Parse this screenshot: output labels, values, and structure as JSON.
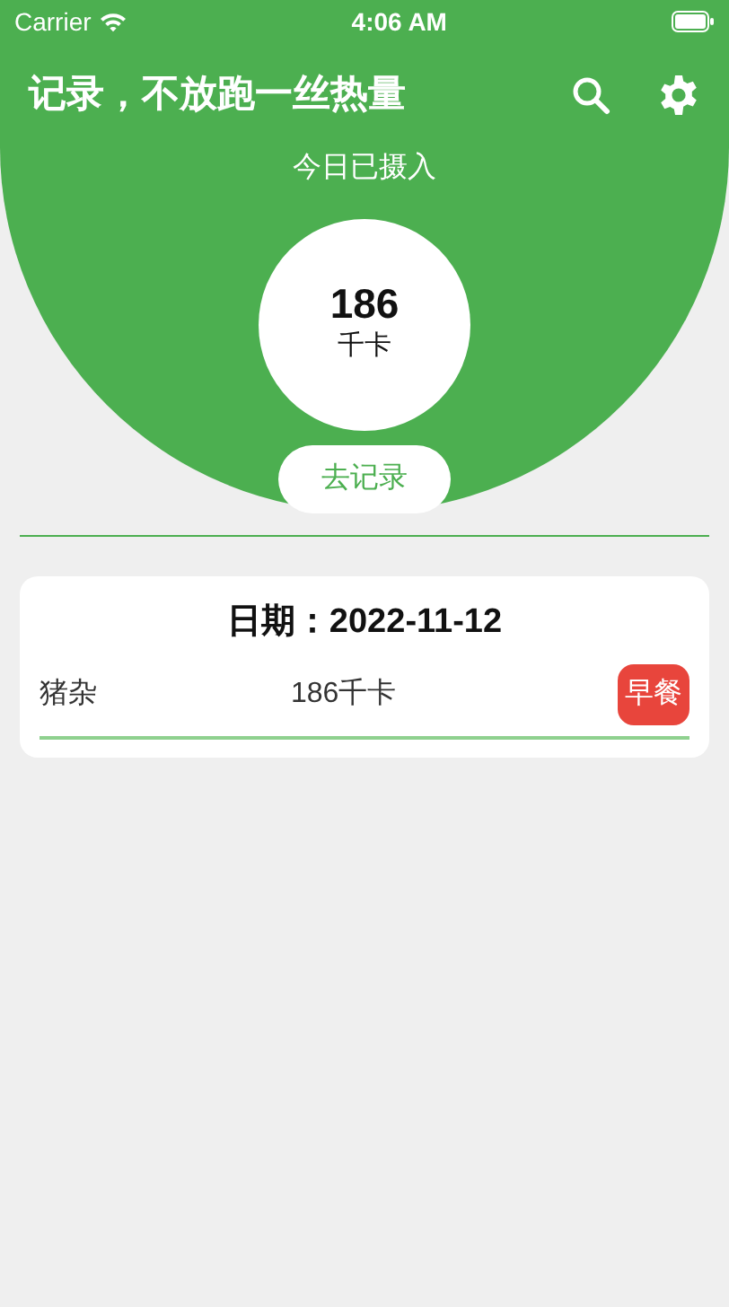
{
  "status_bar": {
    "carrier": "Carrier",
    "time": "4:06 AM"
  },
  "header": {
    "title": "记录，不放跑一丝热量"
  },
  "summary": {
    "caption": "今日已摄入",
    "value": "186",
    "unit": "千卡",
    "button": "去记录"
  },
  "records": [
    {
      "date": "日期：2022-11-12",
      "entries": [
        {
          "food": "猪杂",
          "calories": "186千卡",
          "meal": "早餐",
          "color": "#e8453c"
        }
      ]
    }
  ]
}
